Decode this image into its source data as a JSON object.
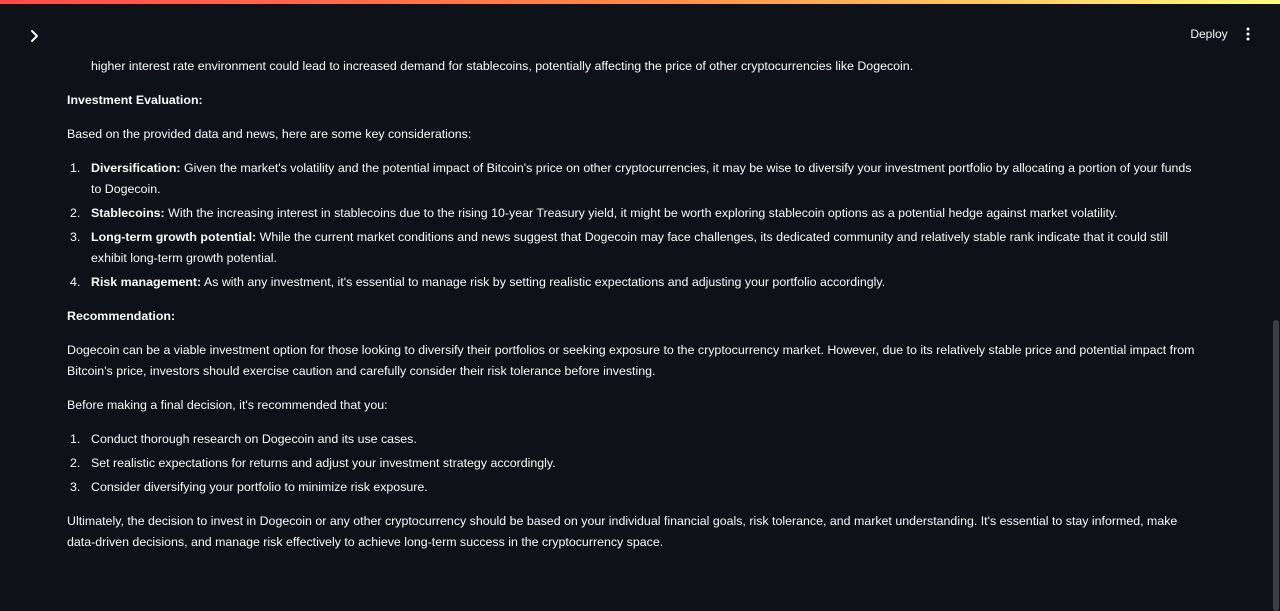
{
  "header": {
    "deploy_label": "Deploy"
  },
  "icons": {
    "sidebar_toggle": "chevron-right-icon",
    "menu": "vertical-dots-icon"
  },
  "colors": {
    "background": "#0e1117",
    "text": "#fafafa",
    "top_gradient": [
      "#ff4b4b",
      "#fffd80"
    ]
  },
  "content": {
    "continued_line": "higher interest rate environment could lead to increased demand for stablecoins, potentially affecting the price of other cryptocurrencies like Dogecoin.",
    "investment_heading": "Investment Evaluation:",
    "investment_intro": "Based on the provided data and news, here are some key considerations:",
    "considerations": [
      {
        "num": "1.",
        "label": "Diversification:",
        "text": " Given the market's volatility and the potential impact of Bitcoin's price on other cryptocurrencies, it may be wise to diversify your investment portfolio by allocating a portion of your funds to Dogecoin."
      },
      {
        "num": "2.",
        "label": "Stablecoins:",
        "text": " With the increasing interest in stablecoins due to the rising 10-year Treasury yield, it might be worth exploring stablecoin options as a potential hedge against market volatility."
      },
      {
        "num": "3.",
        "label": "Long-term growth potential:",
        "text": " While the current market conditions and news suggest that Dogecoin may face challenges, its dedicated community and relatively stable rank indicate that it could still exhibit long-term growth potential."
      },
      {
        "num": "4.",
        "label": "Risk management:",
        "text": " As with any investment, it's essential to manage risk by setting realistic expectations and adjusting your portfolio accordingly."
      }
    ],
    "recommendation_heading": "Recommendation:",
    "recommendation_text": "Dogecoin can be a viable investment option for those looking to diversify their portfolios or seeking exposure to the cryptocurrency market. However, due to its relatively stable price and potential impact from Bitcoin's price, investors should exercise caution and carefully consider their risk tolerance before investing.",
    "before_decision": "Before making a final decision, it's recommended that you:",
    "steps": [
      {
        "num": "1.",
        "text": "Conduct thorough research on Dogecoin and its use cases."
      },
      {
        "num": "2.",
        "text": "Set realistic expectations for returns and adjust your investment strategy accordingly."
      },
      {
        "num": "3.",
        "text": "Consider diversifying your portfolio to minimize risk exposure."
      }
    ],
    "conclusion": "Ultimately, the decision to invest in Dogecoin or any other cryptocurrency should be based on your individual financial goals, risk tolerance, and market understanding. It's essential to stay informed, make data-driven decisions, and manage risk effectively to achieve long-term success in the cryptocurrency space."
  }
}
